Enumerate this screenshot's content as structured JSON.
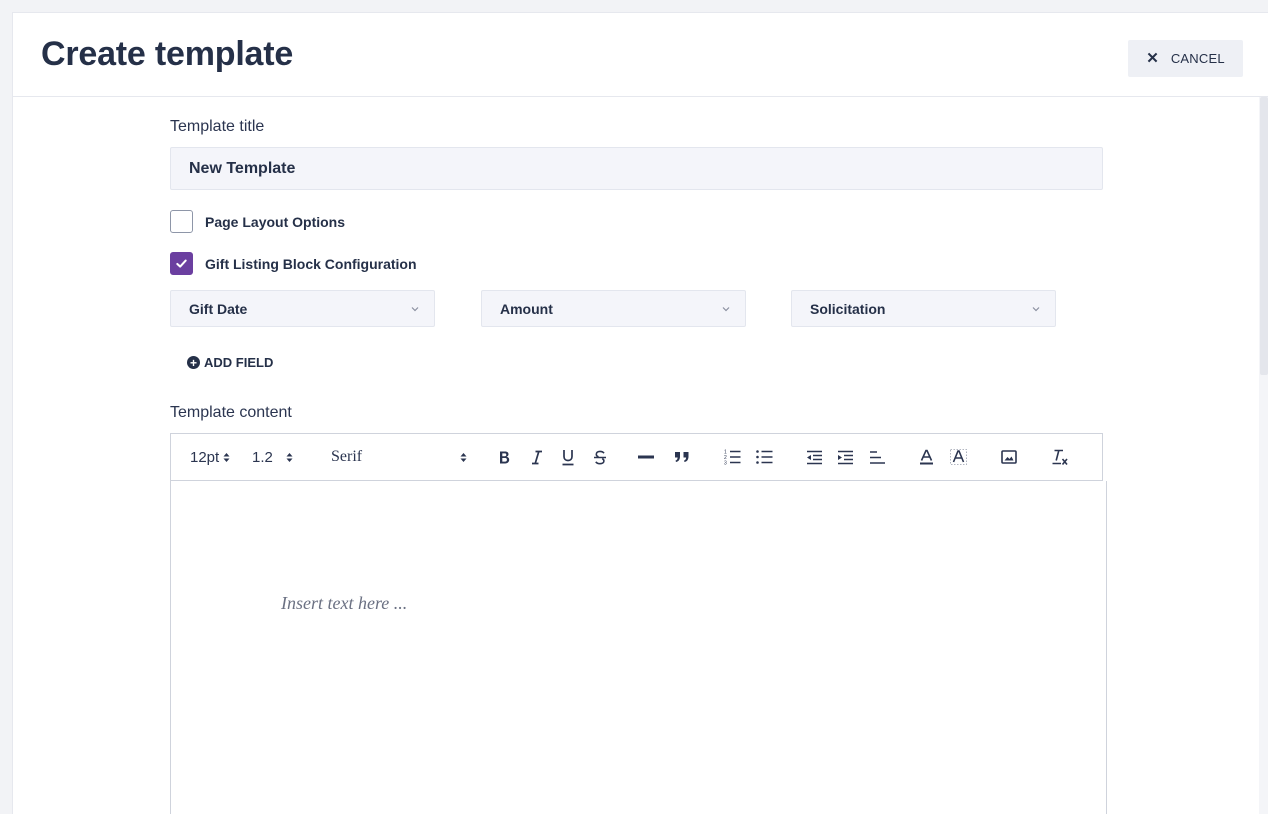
{
  "header": {
    "title": "Create template",
    "cancel_label": "CANCEL",
    "cancel_icon": "close-icon"
  },
  "form": {
    "title_label": "Template title",
    "title_value": "New Template",
    "options": [
      {
        "label": "Page Layout Options",
        "checked": false
      },
      {
        "label": "Gift Listing Block Configuration",
        "checked": true
      }
    ],
    "fields": [
      {
        "value": "Gift Date"
      },
      {
        "value": "Amount"
      },
      {
        "value": "Solicitation"
      }
    ],
    "add_field_label": "ADD FIELD",
    "content_label": "Template content"
  },
  "editor": {
    "font_size": "12pt",
    "line_height": "1.2",
    "font_family": "Serif",
    "tools": [
      "bold-icon",
      "italic-icon",
      "underline-icon",
      "strikethrough-icon",
      "horizontal-rule-icon",
      "blockquote-icon",
      "ordered-list-icon",
      "bullet-list-icon",
      "outdent-icon",
      "indent-icon",
      "align-icon",
      "text-color-icon",
      "highlight-icon",
      "image-icon",
      "clear-format-icon"
    ],
    "placeholder": "Insert text here ..."
  },
  "colors": {
    "accent": "#6b3fa0",
    "text": "#253048",
    "field_bg": "#f4f5fa"
  }
}
